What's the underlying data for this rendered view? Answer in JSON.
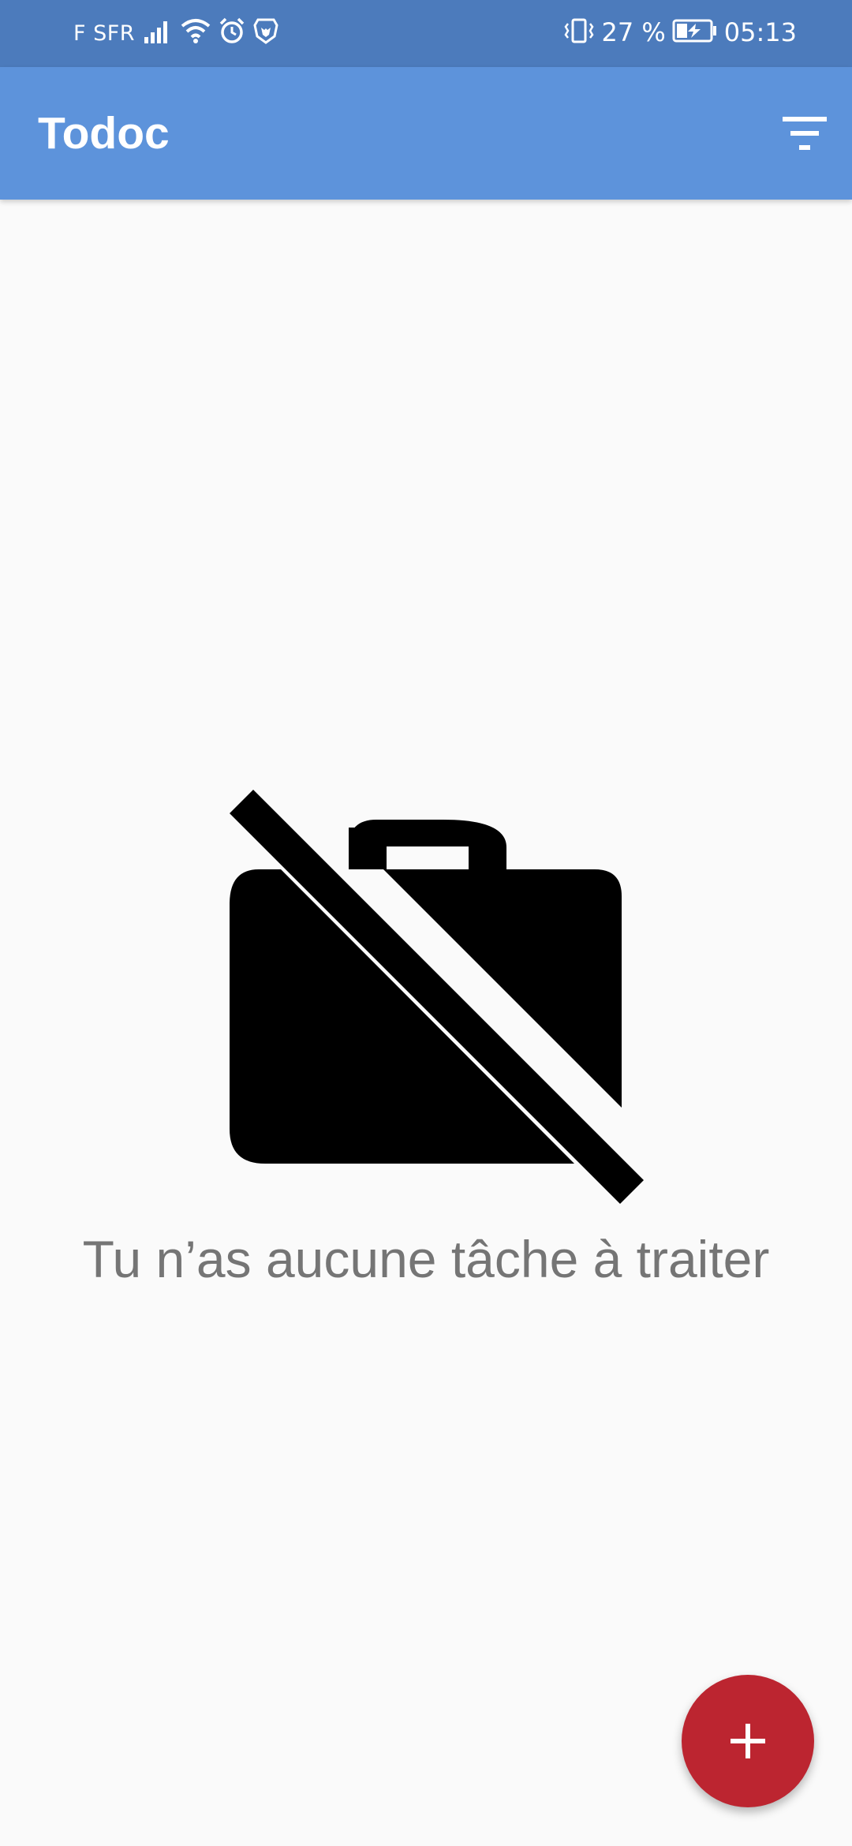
{
  "status_bar": {
    "carrier": "F SFR",
    "battery": "27 %",
    "time": "05:13",
    "icons": [
      "signal-icon",
      "wifi-icon",
      "alarm-icon",
      "brave-lion-icon",
      "vibrate-icon",
      "battery-charging-icon"
    ]
  },
  "app_bar": {
    "title": "Todoc",
    "filter_icon": "filter-list-icon"
  },
  "empty_state": {
    "icon": "work-off-icon",
    "message": "Tu n’as aucune tâche à traiter"
  },
  "fab": {
    "icon": "add-icon"
  },
  "colors": {
    "status_bar": "#4c7bbc",
    "app_bar": "#5d93db",
    "background": "#fafafa",
    "fab": "#bc2530",
    "empty_text": "#757575"
  }
}
